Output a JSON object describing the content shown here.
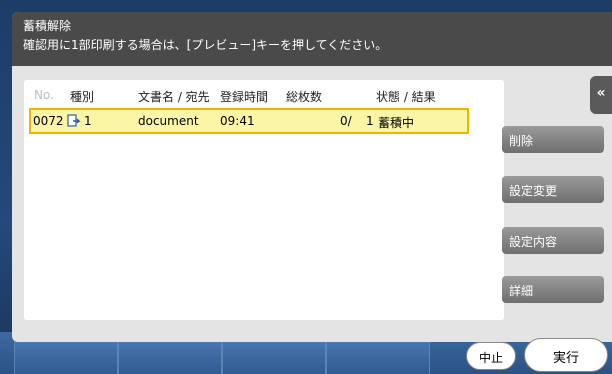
{
  "dialog": {
    "title": "蓄積解除",
    "message": "確認用に1部印刷する場合は、[プレビュー]キーを押してください。"
  },
  "columns": {
    "no": "No.",
    "type": "種別",
    "name": "文書名 / 宛先",
    "time": "登録時間",
    "total": "総枚数",
    "status": "状態 / 結果"
  },
  "rows": [
    {
      "no": "0072",
      "type_icon": "document-icon",
      "copies": "1",
      "name": "document",
      "time": "09:41",
      "pages": "0/",
      "sets": "1",
      "status": "蓄積中"
    }
  ],
  "side_buttons": {
    "delete": "削除",
    "change_settings": "設定変更",
    "settings_detail": "設定内容",
    "details": "詳細"
  },
  "collapse_icon": "double-chevron-left-icon",
  "footer": {
    "stop": "中止",
    "execute": "実行"
  },
  "colors": {
    "header_bg": "#4a4a4a",
    "selection_fill": "#fbf6a6",
    "selection_border": "#f0b400",
    "side_button": "#7f7f7f"
  }
}
